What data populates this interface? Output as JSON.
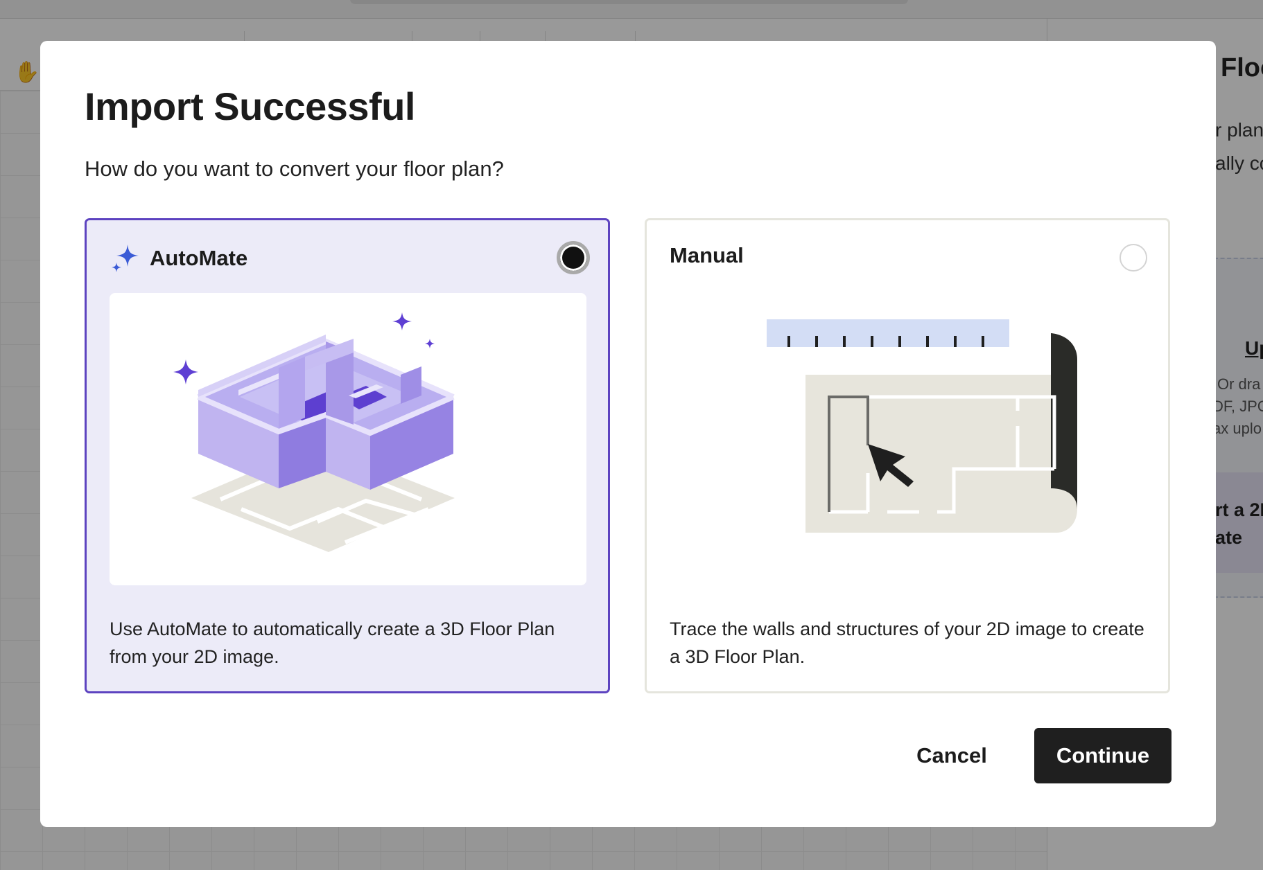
{
  "background": {
    "panel_heading": "Floo",
    "panel_lines": [
      "r plan",
      "ally co"
    ],
    "upload_link": "Up",
    "upload_hints": [
      "Or dra",
      "DF, JPG",
      "ax uplo"
    ],
    "automate_box_lines": [
      "rt a 2D",
      "ate"
    ]
  },
  "dialog": {
    "title": "Import Successful",
    "subtitle": "How do you want to convert your floor plan?",
    "options": [
      {
        "label": "AutoMate",
        "description": "Use AutoMate to automatically create a 3D Floor Plan from your 2D image.",
        "selected": true,
        "icon": "sparkle-icon"
      },
      {
        "label": "Manual",
        "description": "Trace the walls and structures of your 2D image to create a 3D Floor Plan.",
        "selected": false
      }
    ],
    "cancel_label": "Cancel",
    "continue_label": "Continue"
  },
  "colors": {
    "accent": "#5d43c0",
    "selected_card_bg": "#ecebf8",
    "primary_button": "#1f1f1f",
    "ruler_blue": "#d3ddf5"
  }
}
